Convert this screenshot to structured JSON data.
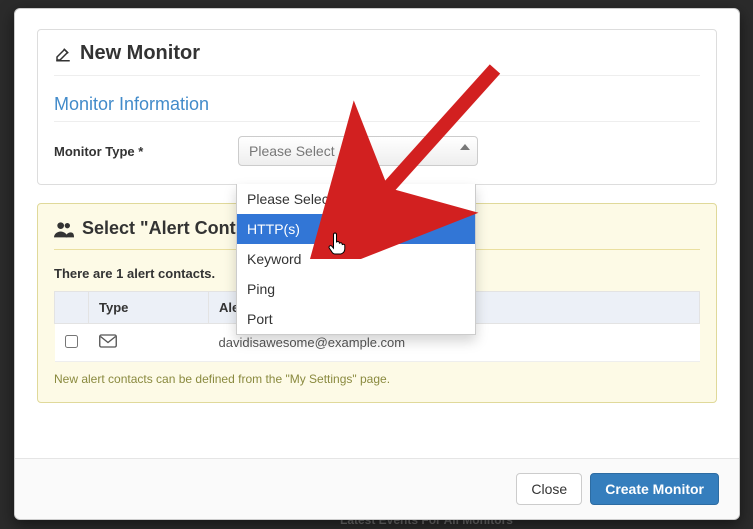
{
  "modal": {
    "title": "New Monitor",
    "section_title": "Monitor Information",
    "form": {
      "type_label": "Monitor Type *",
      "type_selected": "Please Select",
      "type_options": [
        "Please Select",
        "HTTP(s)",
        "Keyword",
        "Ping",
        "Port"
      ],
      "type_highlighted_index": 1
    },
    "contacts": {
      "title": "Select \"Alert Contacts To Notify\"",
      "title_truncated": "Select \"Alert Conta",
      "count_text": "There are 1 alert contacts.",
      "columns": {
        "checkbox": "",
        "type": "Type",
        "contact": "Alert Contact"
      },
      "rows": [
        {
          "checked": false,
          "type_icon": "mail-icon",
          "contact": "davidisawesome@example.com"
        }
      ],
      "hint": "New alert contacts can be defined from the \"My Settings\" page."
    },
    "footer": {
      "close": "Close",
      "create": "Create Monitor"
    }
  },
  "behind": {
    "snippet": "Latest Events For All Monitors"
  },
  "colors": {
    "accent": "#357ebd",
    "link": "#428bca",
    "dropdown_sel": "#3276d6",
    "arrow": "#d22020"
  }
}
